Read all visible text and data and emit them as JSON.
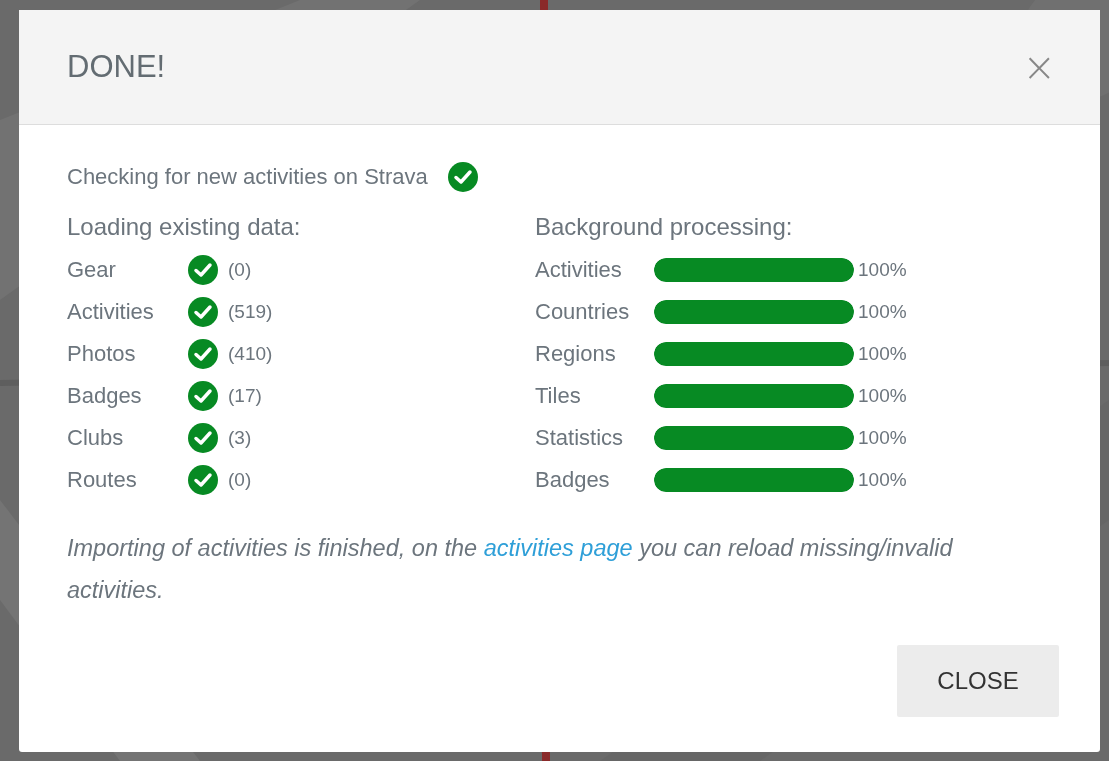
{
  "dialog": {
    "title": "DONE!",
    "close_icon": "×"
  },
  "checking": {
    "label": "Checking for new activities on Strava",
    "done": true
  },
  "loading": {
    "heading": "Loading existing data:",
    "items": [
      {
        "name": "Gear",
        "done": true,
        "count": "(0)"
      },
      {
        "name": "Activities",
        "done": true,
        "count": "(519)"
      },
      {
        "name": "Photos",
        "done": true,
        "count": "(410)"
      },
      {
        "name": "Badges",
        "done": true,
        "count": "(17)"
      },
      {
        "name": "Clubs",
        "done": true,
        "count": "(3)"
      },
      {
        "name": "Routes",
        "done": true,
        "count": "(0)"
      }
    ]
  },
  "processing": {
    "heading": "Background processing:",
    "items": [
      {
        "name": "Activities",
        "level": 1,
        "reading": "100%"
      },
      {
        "name": "Countries",
        "level": 1,
        "reading": "100%"
      },
      {
        "name": "Regions",
        "level": 1,
        "reading": "100%"
      },
      {
        "name": "Tiles",
        "level": 1,
        "reading": "100%"
      },
      {
        "name": "Statistics",
        "level": 1,
        "reading": "100%"
      },
      {
        "name": "Badges",
        "level": 1,
        "reading": "100%"
      }
    ]
  },
  "note": {
    "before": "Importing of activities is finished, on the",
    "link": "activities page",
    "after": "you can reload missing/invalid activities."
  },
  "buttons": [
    "CLOSE"
  ]
}
